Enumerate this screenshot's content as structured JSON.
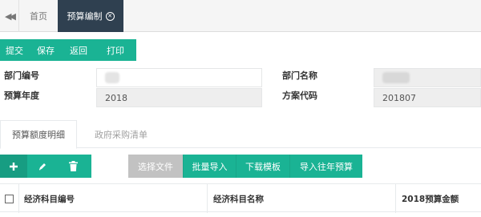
{
  "tabs": {
    "home": "首页",
    "active": "预算编制"
  },
  "toolbar": {
    "submit": "提交",
    "save": "保存",
    "back": "返回",
    "print": "打印"
  },
  "form": {
    "dept_code_label": "部门编号",
    "dept_name_label": "部门名称",
    "budget_year_label": "预算年度",
    "budget_year_value": "2018",
    "plan_code_label": "方案代码",
    "plan_code_value": "201807"
  },
  "subtabs": {
    "detail": "预算额度明细",
    "procurement": "政府采购清单"
  },
  "actions": {
    "select_file": "选择文件",
    "batch_import": "批量导入",
    "download_template": "下载模板",
    "import_previous": "导入往年预算"
  },
  "icons": {
    "add": "plus-icon",
    "edit": "pencil-icon",
    "delete": "trash-icon"
  },
  "table": {
    "columns": [
      "经济科目编号",
      "经济科目名称",
      "2018预算金额"
    ]
  },
  "colors": {
    "accent": "#1ab394",
    "active_tab": "#2f4050",
    "disabled": "#c2c2c2"
  }
}
